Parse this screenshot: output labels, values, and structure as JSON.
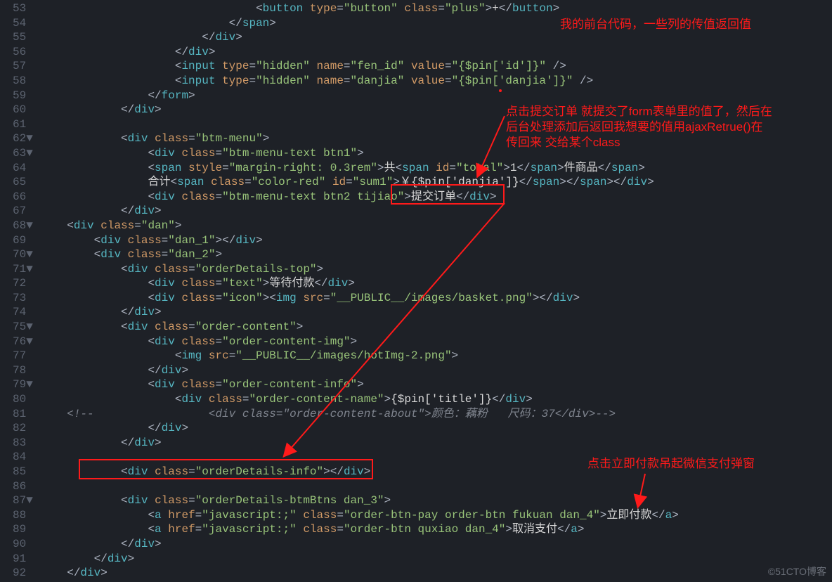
{
  "gutter": {
    "start": 53,
    "end": 92,
    "folds": [
      62,
      63,
      68,
      70,
      71,
      75,
      76,
      79,
      87
    ]
  },
  "annotations": {
    "a1": "我的前台代码，一些列的传值返回值",
    "a2_l1": "点击提交订单 就提交了form表单里的值了，然后在",
    "a2_l2": "后台处理添加后返回我想要的值用ajaxRetrue()在",
    "a2_l3": "传回来 交给某个class",
    "a3": "点击立即付款吊起微信支付弹窗"
  },
  "watermark": "©51CTO博客",
  "code_tokens": {
    "53": [
      [
        "",
        "                                "
      ],
      [
        "br",
        "<"
      ],
      [
        "t",
        "button"
      ],
      [
        "tx",
        " "
      ],
      [
        "at",
        "type"
      ],
      [
        "br",
        "="
      ],
      [
        "st",
        "\"button\""
      ],
      [
        "tx",
        " "
      ],
      [
        "at",
        "class"
      ],
      [
        "br",
        "="
      ],
      [
        "st",
        "\"plus\""
      ],
      [
        "br",
        ">"
      ],
      [
        "tx",
        "+"
      ],
      [
        "br",
        "</"
      ],
      [
        "t",
        "button"
      ],
      [
        "br",
        ">"
      ]
    ],
    "54": [
      [
        "",
        "                            "
      ],
      [
        "br",
        "</"
      ],
      [
        "t",
        "span"
      ],
      [
        "br",
        ">"
      ]
    ],
    "55": [
      [
        "",
        "                        "
      ],
      [
        "br",
        "</"
      ],
      [
        "t",
        "div"
      ],
      [
        "br",
        ">"
      ]
    ],
    "56": [
      [
        "",
        "                    "
      ],
      [
        "br",
        "</"
      ],
      [
        "t",
        "div"
      ],
      [
        "br",
        ">"
      ]
    ],
    "57": [
      [
        "",
        "                    "
      ],
      [
        "br",
        "<"
      ],
      [
        "t",
        "input"
      ],
      [
        "tx",
        " "
      ],
      [
        "at",
        "type"
      ],
      [
        "br",
        "="
      ],
      [
        "st",
        "\"hidden\""
      ],
      [
        "tx",
        " "
      ],
      [
        "at",
        "name"
      ],
      [
        "br",
        "="
      ],
      [
        "st",
        "\"fen_id\""
      ],
      [
        "tx",
        " "
      ],
      [
        "at",
        "value"
      ],
      [
        "br",
        "="
      ],
      [
        "st",
        "\"{$pin['id']}\""
      ],
      [
        "tx",
        " "
      ],
      [
        "br",
        "/>"
      ]
    ],
    "58": [
      [
        "",
        "                    "
      ],
      [
        "br",
        "<"
      ],
      [
        "t",
        "input"
      ],
      [
        "tx",
        " "
      ],
      [
        "at",
        "type"
      ],
      [
        "br",
        "="
      ],
      [
        "st",
        "\"hidden\""
      ],
      [
        "tx",
        " "
      ],
      [
        "at",
        "name"
      ],
      [
        "br",
        "="
      ],
      [
        "st",
        "\"danjia\""
      ],
      [
        "tx",
        " "
      ],
      [
        "at",
        "value"
      ],
      [
        "br",
        "="
      ],
      [
        "st",
        "\"{$pin['danjia']}\""
      ],
      [
        "tx",
        " "
      ],
      [
        "br",
        "/>"
      ]
    ],
    "59": [
      [
        "",
        "                "
      ],
      [
        "br",
        "</"
      ],
      [
        "t",
        "form"
      ],
      [
        "br",
        ">"
      ]
    ],
    "60": [
      [
        "",
        "            "
      ],
      [
        "br",
        "</"
      ],
      [
        "t",
        "div"
      ],
      [
        "br",
        ">"
      ]
    ],
    "61": [
      [
        "",
        ""
      ]
    ],
    "62": [
      [
        "",
        "            "
      ],
      [
        "br",
        "<"
      ],
      [
        "t",
        "div"
      ],
      [
        "tx",
        " "
      ],
      [
        "at",
        "class"
      ],
      [
        "br",
        "="
      ],
      [
        "st",
        "\"btm-menu\""
      ],
      [
        "br",
        ">"
      ]
    ],
    "63": [
      [
        "",
        "                "
      ],
      [
        "br",
        "<"
      ],
      [
        "t",
        "div"
      ],
      [
        "tx",
        " "
      ],
      [
        "at",
        "class"
      ],
      [
        "br",
        "="
      ],
      [
        "st",
        "\"btm-menu-text btn1\""
      ],
      [
        "br",
        ">"
      ]
    ],
    "64": [
      [
        "",
        "                "
      ],
      [
        "br",
        "<"
      ],
      [
        "t",
        "span"
      ],
      [
        "tx",
        " "
      ],
      [
        "at",
        "style"
      ],
      [
        "br",
        "="
      ],
      [
        "st",
        "\"margin-right: 0.3rem\""
      ],
      [
        "br",
        ">"
      ],
      [
        "tx",
        "共"
      ],
      [
        "br",
        "<"
      ],
      [
        "t",
        "span"
      ],
      [
        "tx",
        " "
      ],
      [
        "at",
        "id"
      ],
      [
        "br",
        "="
      ],
      [
        "st",
        "\"total\""
      ],
      [
        "br",
        ">"
      ],
      [
        "tx",
        "1"
      ],
      [
        "br",
        "</"
      ],
      [
        "t",
        "span"
      ],
      [
        "br",
        ">"
      ],
      [
        "tx",
        "件商品"
      ],
      [
        "br",
        "</"
      ],
      [
        "t",
        "span"
      ],
      [
        "br",
        ">"
      ]
    ],
    "65": [
      [
        "",
        "                "
      ],
      [
        "tx",
        "合计"
      ],
      [
        "br",
        "<"
      ],
      [
        "t",
        "span"
      ],
      [
        "tx",
        " "
      ],
      [
        "at",
        "class"
      ],
      [
        "br",
        "="
      ],
      [
        "st",
        "\"color-red\""
      ],
      [
        "tx",
        " "
      ],
      [
        "at",
        "id"
      ],
      [
        "br",
        "="
      ],
      [
        "st",
        "\"sum1\""
      ],
      [
        "br",
        ">"
      ],
      [
        "tx",
        "￥{$pin['danjia']}"
      ],
      [
        "br",
        "</"
      ],
      [
        "t",
        "span"
      ],
      [
        "br",
        ">"
      ],
      [
        "br",
        "</"
      ],
      [
        "t",
        "span"
      ],
      [
        "br",
        ">"
      ],
      [
        "br",
        "</"
      ],
      [
        "t",
        "div"
      ],
      [
        "br",
        ">"
      ]
    ],
    "66": [
      [
        "",
        "                "
      ],
      [
        "br",
        "<"
      ],
      [
        "t",
        "div"
      ],
      [
        "tx",
        " "
      ],
      [
        "at",
        "class"
      ],
      [
        "br",
        "="
      ],
      [
        "st",
        "\"btm-menu-text btn2 tijiao\""
      ],
      [
        "br",
        ">"
      ],
      [
        "tx",
        "提交订单"
      ],
      [
        "br",
        "</"
      ],
      [
        "t",
        "div"
      ],
      [
        "br",
        ">"
      ]
    ],
    "67": [
      [
        "",
        "            "
      ],
      [
        "br",
        "</"
      ],
      [
        "t",
        "div"
      ],
      [
        "br",
        ">"
      ]
    ],
    "68": [
      [
        "",
        "    "
      ],
      [
        "br",
        "<"
      ],
      [
        "t",
        "div"
      ],
      [
        "tx",
        " "
      ],
      [
        "at",
        "class"
      ],
      [
        "br",
        "="
      ],
      [
        "st",
        "\"dan\""
      ],
      [
        "br",
        ">"
      ]
    ],
    "69": [
      [
        "",
        "        "
      ],
      [
        "br",
        "<"
      ],
      [
        "t",
        "div"
      ],
      [
        "tx",
        " "
      ],
      [
        "at",
        "class"
      ],
      [
        "br",
        "="
      ],
      [
        "st",
        "\"dan_1\""
      ],
      [
        "br",
        ">"
      ],
      [
        "br",
        "</"
      ],
      [
        "t",
        "div"
      ],
      [
        "br",
        ">"
      ]
    ],
    "70": [
      [
        "",
        "        "
      ],
      [
        "br",
        "<"
      ],
      [
        "t",
        "div"
      ],
      [
        "tx",
        " "
      ],
      [
        "at",
        "class"
      ],
      [
        "br",
        "="
      ],
      [
        "st",
        "\"dan_2\""
      ],
      [
        "br",
        ">"
      ]
    ],
    "71": [
      [
        "",
        "            "
      ],
      [
        "br",
        "<"
      ],
      [
        "t",
        "div"
      ],
      [
        "tx",
        " "
      ],
      [
        "at",
        "class"
      ],
      [
        "br",
        "="
      ],
      [
        "st",
        "\"orderDetails-top\""
      ],
      [
        "br",
        ">"
      ]
    ],
    "72": [
      [
        "",
        "                "
      ],
      [
        "br",
        "<"
      ],
      [
        "t",
        "div"
      ],
      [
        "tx",
        " "
      ],
      [
        "at",
        "class"
      ],
      [
        "br",
        "="
      ],
      [
        "st",
        "\"text\""
      ],
      [
        "br",
        ">"
      ],
      [
        "tx",
        "等待付款"
      ],
      [
        "br",
        "</"
      ],
      [
        "t",
        "div"
      ],
      [
        "br",
        ">"
      ]
    ],
    "73": [
      [
        "",
        "                "
      ],
      [
        "br",
        "<"
      ],
      [
        "t",
        "div"
      ],
      [
        "tx",
        " "
      ],
      [
        "at",
        "class"
      ],
      [
        "br",
        "="
      ],
      [
        "st",
        "\"icon\""
      ],
      [
        "br",
        ">"
      ],
      [
        "br",
        "<"
      ],
      [
        "t",
        "img"
      ],
      [
        "tx",
        " "
      ],
      [
        "at",
        "src"
      ],
      [
        "br",
        "="
      ],
      [
        "st",
        "\"__PUBLIC__/images/basket.png\""
      ],
      [
        "br",
        ">"
      ],
      [
        "br",
        "</"
      ],
      [
        "t",
        "div"
      ],
      [
        "br",
        ">"
      ]
    ],
    "74": [
      [
        "",
        "            "
      ],
      [
        "br",
        "</"
      ],
      [
        "t",
        "div"
      ],
      [
        "br",
        ">"
      ]
    ],
    "75": [
      [
        "",
        "            "
      ],
      [
        "br",
        "<"
      ],
      [
        "t",
        "div"
      ],
      [
        "tx",
        " "
      ],
      [
        "at",
        "class"
      ],
      [
        "br",
        "="
      ],
      [
        "st",
        "\"order-content\""
      ],
      [
        "br",
        ">"
      ]
    ],
    "76": [
      [
        "",
        "                "
      ],
      [
        "br",
        "<"
      ],
      [
        "t",
        "div"
      ],
      [
        "tx",
        " "
      ],
      [
        "at",
        "class"
      ],
      [
        "br",
        "="
      ],
      [
        "st",
        "\"order-content-img\""
      ],
      [
        "br",
        ">"
      ]
    ],
    "77": [
      [
        "",
        "                    "
      ],
      [
        "br",
        "<"
      ],
      [
        "t",
        "img"
      ],
      [
        "tx",
        " "
      ],
      [
        "at",
        "src"
      ],
      [
        "br",
        "="
      ],
      [
        "st",
        "\"__PUBLIC__/images/hotImg-2.png\""
      ],
      [
        "br",
        ">"
      ]
    ],
    "78": [
      [
        "",
        "                "
      ],
      [
        "br",
        "</"
      ],
      [
        "t",
        "div"
      ],
      [
        "br",
        ">"
      ]
    ],
    "79": [
      [
        "",
        "                "
      ],
      [
        "br",
        "<"
      ],
      [
        "t",
        "div"
      ],
      [
        "tx",
        " "
      ],
      [
        "at",
        "class"
      ],
      [
        "br",
        "="
      ],
      [
        "st",
        "\"order-content-info\""
      ],
      [
        "br",
        ">"
      ]
    ],
    "80": [
      [
        "",
        "                    "
      ],
      [
        "br",
        "<"
      ],
      [
        "t",
        "div"
      ],
      [
        "tx",
        " "
      ],
      [
        "at",
        "class"
      ],
      [
        "br",
        "="
      ],
      [
        "st",
        "\"order-content-name\""
      ],
      [
        "br",
        ">"
      ],
      [
        "tx",
        "{$pin['title']}"
      ],
      [
        "br",
        "</"
      ],
      [
        "t",
        "div"
      ],
      [
        "br",
        ">"
      ]
    ],
    "81": [
      [
        "",
        "    "
      ],
      [
        "cm",
        "<!--                 <div class=\"order-content-about\">颜色：藕粉   尺码：37</div>-->"
      ]
    ],
    "82": [
      [
        "",
        "                "
      ],
      [
        "br",
        "</"
      ],
      [
        "t",
        "div"
      ],
      [
        "br",
        ">"
      ]
    ],
    "83": [
      [
        "",
        "            "
      ],
      [
        "br",
        "</"
      ],
      [
        "t",
        "div"
      ],
      [
        "br",
        ">"
      ]
    ],
    "84": [
      [
        "",
        ""
      ]
    ],
    "85": [
      [
        "",
        "            "
      ],
      [
        "br",
        "<"
      ],
      [
        "t",
        "div"
      ],
      [
        "tx",
        " "
      ],
      [
        "at",
        "class"
      ],
      [
        "br",
        "="
      ],
      [
        "st",
        "\"orderDetails-info\""
      ],
      [
        "br",
        ">"
      ],
      [
        "br",
        "</"
      ],
      [
        "t",
        "div"
      ],
      [
        "br",
        ">"
      ]
    ],
    "86": [
      [
        "",
        ""
      ]
    ],
    "87": [
      [
        "",
        "            "
      ],
      [
        "br",
        "<"
      ],
      [
        "t",
        "div"
      ],
      [
        "tx",
        " "
      ],
      [
        "at",
        "class"
      ],
      [
        "br",
        "="
      ],
      [
        "st",
        "\"orderDetails-btmBtns dan_3\""
      ],
      [
        "br",
        ">"
      ]
    ],
    "88": [
      [
        "",
        "                "
      ],
      [
        "br",
        "<"
      ],
      [
        "t",
        "a"
      ],
      [
        "tx",
        " "
      ],
      [
        "at",
        "href"
      ],
      [
        "br",
        "="
      ],
      [
        "st",
        "\"javascript:;\""
      ],
      [
        "tx",
        " "
      ],
      [
        "at",
        "class"
      ],
      [
        "br",
        "="
      ],
      [
        "st",
        "\"order-btn-pay order-btn fukuan dan_4\""
      ],
      [
        "br",
        ">"
      ],
      [
        "tx",
        "立即付款"
      ],
      [
        "br",
        "</"
      ],
      [
        "t",
        "a"
      ],
      [
        "br",
        ">"
      ]
    ],
    "89": [
      [
        "",
        "                "
      ],
      [
        "br",
        "<"
      ],
      [
        "t",
        "a"
      ],
      [
        "tx",
        " "
      ],
      [
        "at",
        "href"
      ],
      [
        "br",
        "="
      ],
      [
        "st",
        "\"javascript:;\""
      ],
      [
        "tx",
        " "
      ],
      [
        "at",
        "class"
      ],
      [
        "br",
        "="
      ],
      [
        "st",
        "\"order-btn quxiao dan_4\""
      ],
      [
        "br",
        ">"
      ],
      [
        "tx",
        "取消支付"
      ],
      [
        "br",
        "</"
      ],
      [
        "t",
        "a"
      ],
      [
        "br",
        ">"
      ]
    ],
    "90": [
      [
        "",
        "            "
      ],
      [
        "br",
        "</"
      ],
      [
        "t",
        "div"
      ],
      [
        "br",
        ">"
      ]
    ],
    "91": [
      [
        "",
        "        "
      ],
      [
        "br",
        "</"
      ],
      [
        "t",
        "div"
      ],
      [
        "br",
        ">"
      ]
    ],
    "92": [
      [
        "",
        "    "
      ],
      [
        "br",
        "</"
      ],
      [
        "t",
        "div"
      ],
      [
        "br",
        ">"
      ]
    ]
  }
}
